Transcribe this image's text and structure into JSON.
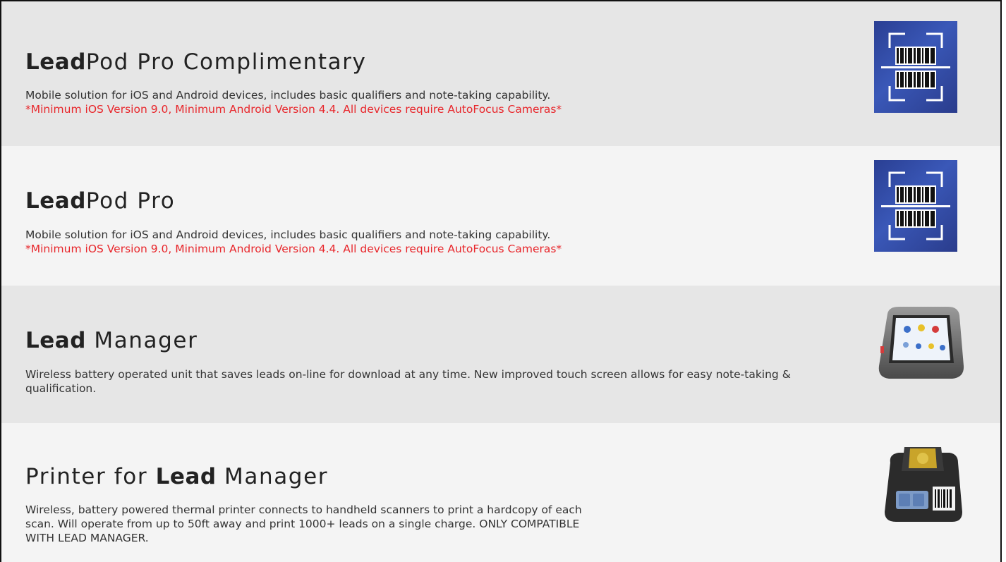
{
  "products": [
    {
      "title_bold": "Lead",
      "title_rest": "Pod Pro Complimentary",
      "description": "Mobile solution for iOS and Android devices, includes basic qualifiers and note-taking capability.",
      "warning": "*Minimum iOS Version 9.0, Minimum Android Version 4.4. All devices require AutoFocus Cameras*",
      "icon": "barcode-scanner-app-icon"
    },
    {
      "title_bold": "Lead",
      "title_rest": "Pod Pro",
      "description": "Mobile solution for iOS and Android devices, includes basic qualifiers and note-taking capability.",
      "warning": "*Minimum iOS Version 9.0, Minimum Android Version 4.4. All devices require AutoFocus Cameras*",
      "icon": "barcode-scanner-app-icon"
    },
    {
      "title_bold": "Lead",
      "title_rest": " Manager",
      "description": "Wireless battery operated unit that saves leads on-line for download at any time. New improved touch screen allows for easy note-taking & qualification.",
      "icon": "touchscreen-device-image"
    },
    {
      "title_prefix": "Printer for ",
      "title_bold": "Lead",
      "title_rest": " Manager",
      "description": "Wireless, battery powered thermal printer connects to handheld scanners to print a hardcopy of each scan. Will operate from up to 50ft away and print 1000+ leads on a single charge. ONLY COMPATIBLE WITH LEAD MANAGER.",
      "icon": "thermal-printer-image"
    }
  ],
  "colors": {
    "warning": "#e8262b",
    "row_dark": "#e6e6e6",
    "row_light": "#f4f4f4",
    "icon_blue": "#2f4aa6"
  }
}
